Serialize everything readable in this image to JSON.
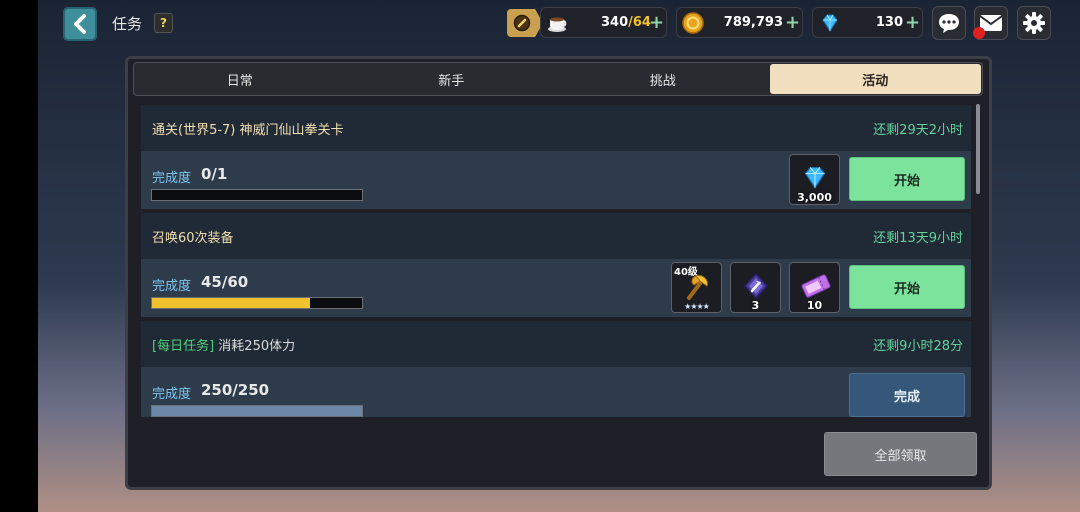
{
  "header": {
    "title": "任务",
    "help_label": "?"
  },
  "resources": {
    "stamina": {
      "current": "340",
      "max": "/64",
      "plus": "+"
    },
    "gold": {
      "value": "789,793",
      "plus": "+"
    },
    "gems": {
      "value": "130",
      "plus": "+"
    }
  },
  "tabs": [
    {
      "label": "日常",
      "active": false
    },
    {
      "label": "新手",
      "active": false
    },
    {
      "label": "挑战",
      "active": false
    },
    {
      "label": "活动",
      "active": true
    }
  ],
  "quests": [
    {
      "tag": "",
      "title": "通关(世界5-7) 神威门仙山拳关卡",
      "remaining": "还剩29天2小时",
      "progress_label": "完成度",
      "progress_text": "0/1",
      "progress_fraction": 0,
      "rewards": [
        {
          "icon": "gem-icon",
          "count": "3,000"
        }
      ],
      "action_label": "开始",
      "action_state": "start"
    },
    {
      "tag": "",
      "title": "召唤60次装备",
      "remaining": "还剩13天9小时",
      "progress_label": "完成度",
      "progress_text": "45/60",
      "progress_fraction": 0.75,
      "rewards": [
        {
          "icon": "golden-axe-icon",
          "level": "40级",
          "stars": "★★★★"
        },
        {
          "icon": "crystal-hammer-icon",
          "count": "3"
        },
        {
          "icon": "ticket-icon",
          "count": "10"
        }
      ],
      "action_label": "开始",
      "action_state": "start"
    },
    {
      "tag": "[每日任务]",
      "title": "消耗250体力",
      "remaining": "还剩9小时28分",
      "progress_label": "完成度",
      "progress_text": "250/250",
      "progress_fraction": 1,
      "rewards": [],
      "action_label": "完成",
      "action_state": "complete"
    }
  ],
  "footer": {
    "claim_all_label": "全部领取"
  },
  "colors": {
    "accent_green": "#7be39b",
    "remaining_text": "#64d29a",
    "progress_fill": "#f2c12e",
    "active_tab": "#f1dfc0"
  }
}
